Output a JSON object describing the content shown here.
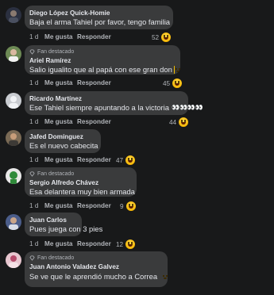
{
  "labels": {
    "like": "Me gusta",
    "reply": "Responder",
    "fan_badge": "Fan destacado"
  },
  "icons": {
    "fan_badge": "diamond-icon",
    "reaction": "laughing-emoji-icon"
  },
  "colors": {
    "background": "#18191a",
    "bubble": "#3a3b3c",
    "name": "#e4e6eb",
    "meta": "#b0b3b8",
    "reaction": "#f5c000"
  },
  "comments": [
    {
      "name": "Diego López Quick-Homie",
      "fan": false,
      "text": "Baja el arma Tahiel por favor, tengo familia",
      "time": "1 d",
      "reactions": "52",
      "avatar": "dark-portrait"
    },
    {
      "name": "Ariel Ramírez",
      "fan": true,
      "text": "Salio igualito que al papá con ese gran don",
      "trailing": "sweat-smile-emoji",
      "time": "1 d",
      "reactions": "45",
      "avatar": "green-outdoor"
    },
    {
      "name": "Ricardo Martínez",
      "fan": false,
      "text": "Ese Tahiel siempre apuntando a la victoria",
      "trailing_text": "👀👀👀👀",
      "time": "1 d",
      "reactions": "44",
      "avatar": "default-gray"
    },
    {
      "name": "Jafed Domínguez",
      "fan": false,
      "text": "Es el nuevo cabecita",
      "time": "1 d",
      "reactions": "47",
      "avatar": "brown-portrait"
    },
    {
      "name": "Sergio Alfredo Chávez",
      "fan": true,
      "text": "Esa delantera muy bien armada",
      "time": "1 d",
      "reactions": "9",
      "avatar": "green-team"
    },
    {
      "name": "Juan Carlos",
      "fan": false,
      "text": "Pues juega con 3 pies",
      "time": "1 d",
      "reactions": "12",
      "avatar": "blue-portrait"
    },
    {
      "name": "Juan Antonio Valadez Galvez",
      "fan": true,
      "text": "Se ve que le aprendió mucho a Correa",
      "trailing": "sweat-smile-emoji",
      "time": "1 d",
      "reactions": "",
      "avatar": "pink-portrait"
    }
  ]
}
